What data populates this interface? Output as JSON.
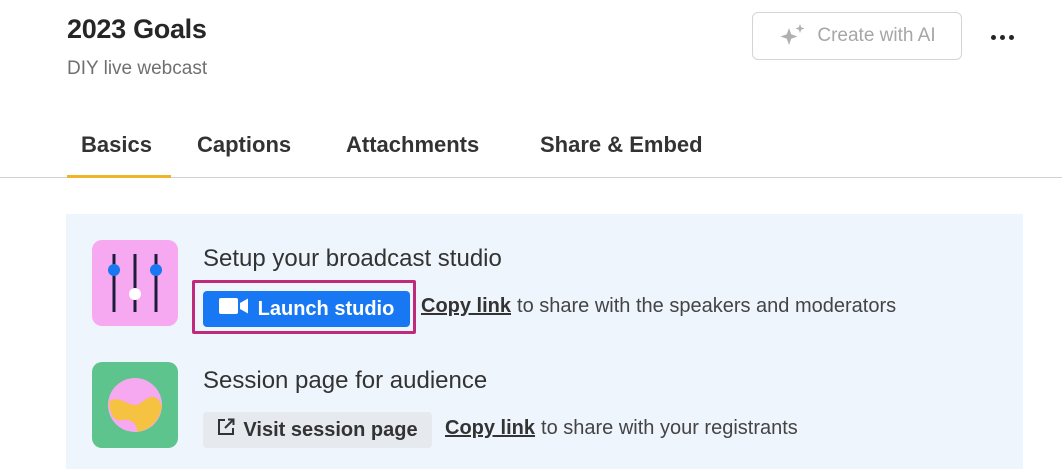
{
  "header": {
    "title": "2023 Goals",
    "subtitle": "DIY live webcast",
    "create_ai_label": "Create with AI",
    "create_ai_icon": "sparkle-icon",
    "more_icon": "more-horizontal-icon"
  },
  "tabs": [
    {
      "label": "Basics",
      "active": true
    },
    {
      "label": "Captions",
      "active": false
    },
    {
      "label": "Attachments",
      "active": false
    },
    {
      "label": "Share & Embed",
      "active": false
    }
  ],
  "studio": {
    "title": "Setup your broadcast studio",
    "icon": "mixer-sliders-icon",
    "launch_label": "Launch studio",
    "launch_icon": "video-camera-icon",
    "copy_link_label": "Copy link",
    "copy_link_suffix": "to share with the speakers and moderators"
  },
  "session": {
    "title": "Session page for audience",
    "icon": "session-page-icon",
    "visit_label": "Visit session page",
    "visit_icon": "external-link-icon",
    "copy_link_label": "Copy link",
    "copy_link_suffix": "to share with your registrants"
  },
  "colors": {
    "accent_tab": "#f0b429",
    "primary_button": "#1877f2",
    "highlight_border": "#c02a7b",
    "card_bg": "#eef5fd",
    "studio_tile": "#f6a8f0",
    "session_tile": "#5cc48c"
  }
}
